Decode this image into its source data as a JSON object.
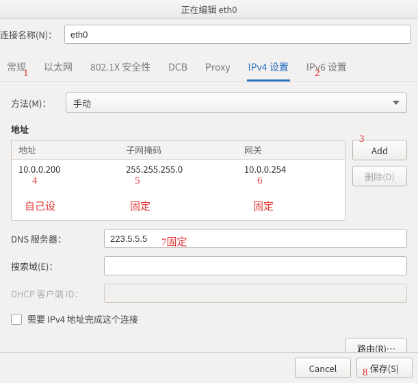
{
  "window": {
    "title": "正在编辑 eth0"
  },
  "connection": {
    "name_label": "连接名称(N)：",
    "name_value": "eth0"
  },
  "tabs": {
    "general": "常规",
    "ethernet": "以太网",
    "security_8021x": "802.1X 安全性",
    "dcb": "DCB",
    "proxy": "Proxy",
    "ipv4": "IPv4 设置",
    "ipv6": "IPv6 设置"
  },
  "ipv4": {
    "method_label": "方法(M)：",
    "method_value": "手动",
    "addresses_label": "地址",
    "columns": {
      "address": "地址",
      "netmask": "子网掩码",
      "gateway": "网关"
    },
    "rows": [
      {
        "address": "10.0.0.200",
        "netmask": "255.255.255.0",
        "gateway": "10.0.0.254"
      }
    ],
    "add_button": "Add",
    "delete_button": "删除(D)",
    "dns_label": "DNS 服务器：",
    "dns_value": "223.5.5.5",
    "search_label": "搜索域(E)：",
    "search_value": "",
    "dhcp_client_label": "DHCP 客户端 ID：",
    "dhcp_client_value": "",
    "require_ipv4_label": "需要 IPv4 地址完成这个连接",
    "routes_button": "路由(R)…"
  },
  "footer": {
    "cancel": "Cancel",
    "save": "保存(S)"
  },
  "annotations": {
    "n1": "1",
    "n2": "2",
    "n3": "3",
    "n4": "4",
    "n5": "5",
    "n6": "6",
    "t4": "自己设",
    "t5": "固定",
    "t6": "固定",
    "n7": "7固定",
    "n8": "8"
  }
}
